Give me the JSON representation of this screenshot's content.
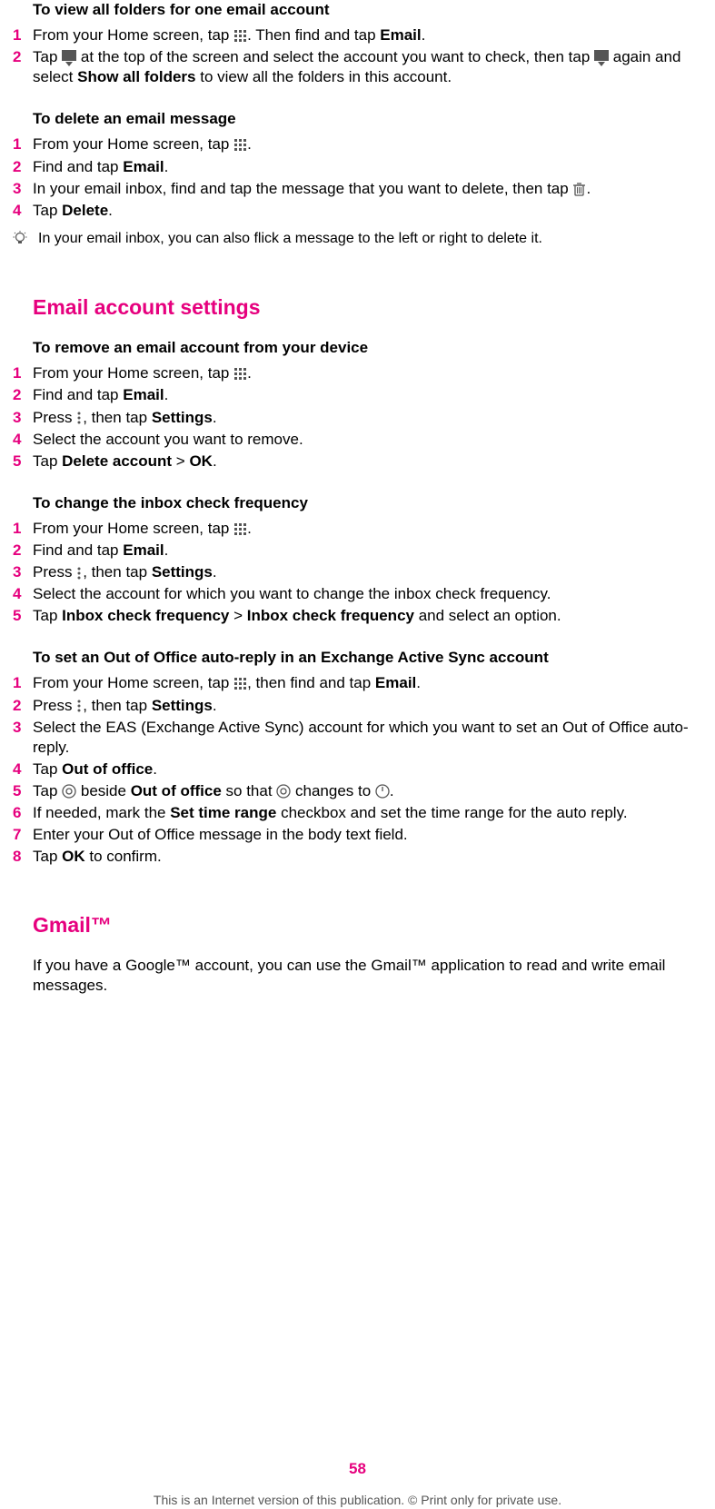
{
  "sections": {
    "s1": {
      "heading": "To view all folders for one email account",
      "step1a": "From your Home screen, tap ",
      "step1b": ". Then find and tap ",
      "step1c": ".",
      "email": "Email",
      "step2a": "Tap ",
      "step2b": " at the top of the screen and select the account you want to check, then tap ",
      "step2c": " again and select ",
      "show_all": "Show all folders",
      "step2d": " to view all the folders in this account."
    },
    "s2": {
      "heading": "To delete an email message",
      "step1a": "From your Home screen, tap ",
      "step1b": ".",
      "step2a": "Find and tap ",
      "step2b": ".",
      "email": "Email",
      "step3a": "In your email inbox, find and tap the message that you want to delete, then tap ",
      "step3b": ".",
      "step4a": "Tap ",
      "step4b": ".",
      "delete": "Delete",
      "tip": "In your email inbox, you can also flick a message to the left or right to delete it."
    },
    "s3_title": "Email account settings",
    "s3a": {
      "heading": "To remove an email account from your device",
      "step1a": "From your Home screen, tap ",
      "step1b": ".",
      "step2a": "Find and tap ",
      "email": "Email",
      "step2b": ".",
      "step3a": "Press ",
      "step3b": ", then tap ",
      "settings": "Settings",
      "step3c": ".",
      "step4": "Select the account you want to remove.",
      "step5a": "Tap ",
      "del_acc": "Delete account",
      "gt": " > ",
      "ok": "OK",
      "step5b": "."
    },
    "s3b": {
      "heading": "To change the inbox check frequency",
      "step1a": "From your Home screen, tap ",
      "step1b": ".",
      "step2a": "Find and tap ",
      "email": "Email",
      "step2b": ".",
      "step3a": "Press ",
      "step3b": ", then tap ",
      "settings": "Settings",
      "step3c": ".",
      "step4": "Select the account for which you want to change the inbox check frequency.",
      "step5a": "Tap ",
      "icf1": "Inbox check frequency",
      "gt": " > ",
      "icf2": "Inbox check frequency",
      "step5b": " and select an option."
    },
    "s3c": {
      "heading": "To set an Out of Office auto-reply in an Exchange Active Sync account",
      "step1a": "From your Home screen, tap ",
      "step1b": ", then find and tap ",
      "email": "Email",
      "step1c": ".",
      "step2a": "Press ",
      "step2b": ", then tap ",
      "settings": "Settings",
      "step2c": ".",
      "step3": "Select the EAS (Exchange Active Sync) account for which you want to set an Out of Office auto-reply.",
      "step4a": "Tap ",
      "ooo": "Out of office",
      "step4b": ".",
      "step5a": "Tap ",
      "step5b": " beside ",
      "ooo2": "Out of office",
      "step5c": " so that ",
      "step5d": " changes to ",
      "step5e": ".",
      "step6a": "If needed, mark the ",
      "set_time": "Set time range",
      "step6b": " checkbox and set the time range for the auto reply.",
      "step7": "Enter your Out of Office message in the body text field.",
      "step8a": "Tap ",
      "ok": "OK",
      "step8b": " to confirm."
    },
    "s4_title": "Gmail™",
    "s4_para": "If you have a Google™ account, you can use the Gmail™ application to read and write email messages."
  },
  "page_number": "58",
  "footer": "This is an Internet version of this publication. © Print only for private use.",
  "nums": {
    "n1": "1",
    "n2": "2",
    "n3": "3",
    "n4": "4",
    "n5": "5",
    "n6": "6",
    "n7": "7",
    "n8": "8"
  }
}
